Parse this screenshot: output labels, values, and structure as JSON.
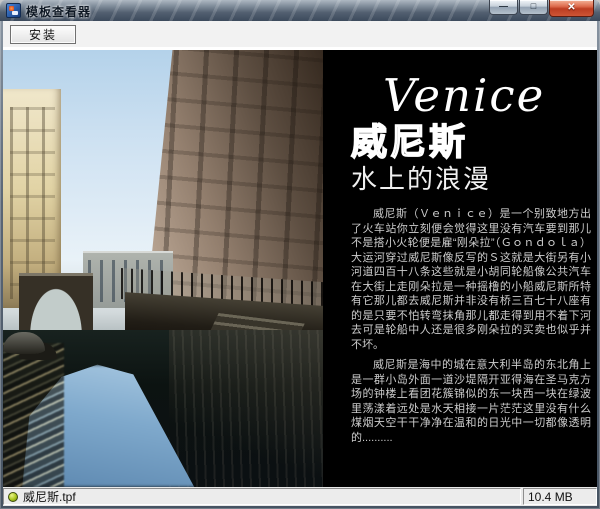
{
  "window": {
    "title": "模板查看器"
  },
  "titlebar": {
    "icons": {
      "minimize": "—",
      "maximize": "□",
      "close": "✕"
    }
  },
  "toolbar": {
    "install_label": "安装"
  },
  "panel": {
    "title_en": "Venice",
    "title_cn": "威尼斯",
    "subtitle": "水上的浪漫",
    "paragraph1": "威尼斯（Ｖｅｎｉｃｅ）是一个别致地方出了火车站你立刻便会觉得这里没有汽车要到那儿不是搭小火轮便是雇“刚朵拉”（Ｇｏｎｄｏｌａ）大运河穿过威尼斯像反写的Ｓ这就是大街另有小河道四百十八条这些就是小胡同轮船像公共汽车在大街上走刚朵拉是一种摇橹的小船威尼斯所特有它那儿都去威尼斯并非没有桥三百七十八座有的是只要不怕转弯抹角那儿都走得到用不着下河去可是轮船中人还是很多刚朵拉的买卖也似乎并不坏。",
    "paragraph2": "威尼斯是海中的城在意大利半岛的东北角上是一群小岛外面一道沙堤隔开亚得海在圣马克方场的钟楼上看团花簇锦似的东一块西一块在绿波里荡漾着远处是水天相接一片茫茫这里没有什么煤烟天空干干净净在温和的日光中一切都像透明的.........."
  },
  "statusbar": {
    "filename": "威尼斯.tpf",
    "filesize": "10.4 MB"
  },
  "colors": {
    "close_button_red": "#c8452a",
    "status_orb_green": "#aac61e",
    "panel_background": "#000000",
    "titlebar_glass": "#526070"
  }
}
